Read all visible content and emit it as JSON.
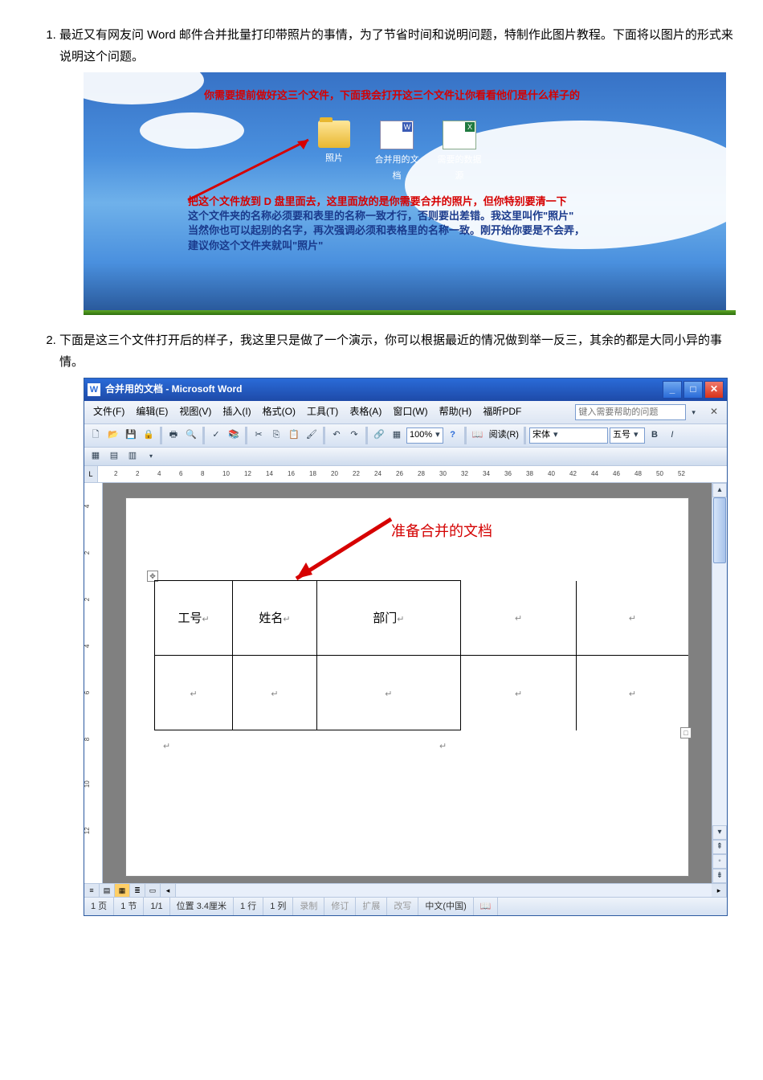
{
  "list": {
    "item1": "最近又有网友问 Word 邮件合并批量打印带照片的事情，为了节省时间和说明问题，特制作此图片教程。下面将以图片的形式来说明这个问题。",
    "item2": "下面是这三个文件打开后的样子，我这里只是做了一个演示，你可以根据最近的情况做到举一反三，其余的都是大同小异的事情。"
  },
  "desktop": {
    "note_top": "你需要提前做好这三个文件，下面我会打开这三个文件让你看看他们是什么样子的",
    "icons": {
      "folder": "照片",
      "doc": "合并用的文档",
      "xls": "需要的数据源"
    },
    "note_bottom_l1": "把这个文件放到 D 盘里面去，这里面放的是你需要合并的照片，但你特别要清一下",
    "note_bottom_l2": "这个文件夹的名称必须要和表里的名称一致才行，否则要出差错。我这里叫作\"照片\"",
    "note_bottom_l3": "当然你也可以起别的名字，再次强调必须和表格里的名称一致。刚开始你要是不会弄，",
    "note_bottom_l4": "建议你这个文件夹就叫\"照片\""
  },
  "word": {
    "title": "合并用的文档 - Microsoft Word",
    "menu": {
      "file": "文件(F)",
      "edit": "编辑(E)",
      "view": "视图(V)",
      "insert": "插入(I)",
      "format": "格式(O)",
      "tools": "工具(T)",
      "table": "表格(A)",
      "window": "窗口(W)",
      "help": "帮助(H)",
      "foxit": "福昕PDF"
    },
    "helpbox": "键入需要帮助的问题",
    "toolbar": {
      "zoom": "100%",
      "read": "阅读(R)",
      "font": "宋体",
      "size": "五号"
    },
    "ruler_nums": [
      "2",
      "2",
      "4",
      "6",
      "8",
      "10",
      "12",
      "14",
      "16",
      "18",
      "20",
      "22",
      "24",
      "26",
      "28",
      "30",
      "32",
      "34",
      "36",
      "38",
      "40",
      "42",
      "44",
      "46",
      "48",
      "50",
      "52"
    ],
    "vruler_nums": [
      "4",
      "2",
      "2",
      "4",
      "6",
      "8",
      "10",
      "12"
    ],
    "doc": {
      "label": "准备合并的文档",
      "col1": "工号",
      "col2": "姓名",
      "col3": "部门"
    },
    "status": {
      "page": "1 页",
      "sec": "1 节",
      "pof": "1/1",
      "pos": "位置 3.4厘米",
      "line": "1 行",
      "col": "1 列",
      "rec": "录制",
      "rev": "修订",
      "ext": "扩展",
      "ovr": "改写",
      "lang": "中文(中国)"
    }
  }
}
